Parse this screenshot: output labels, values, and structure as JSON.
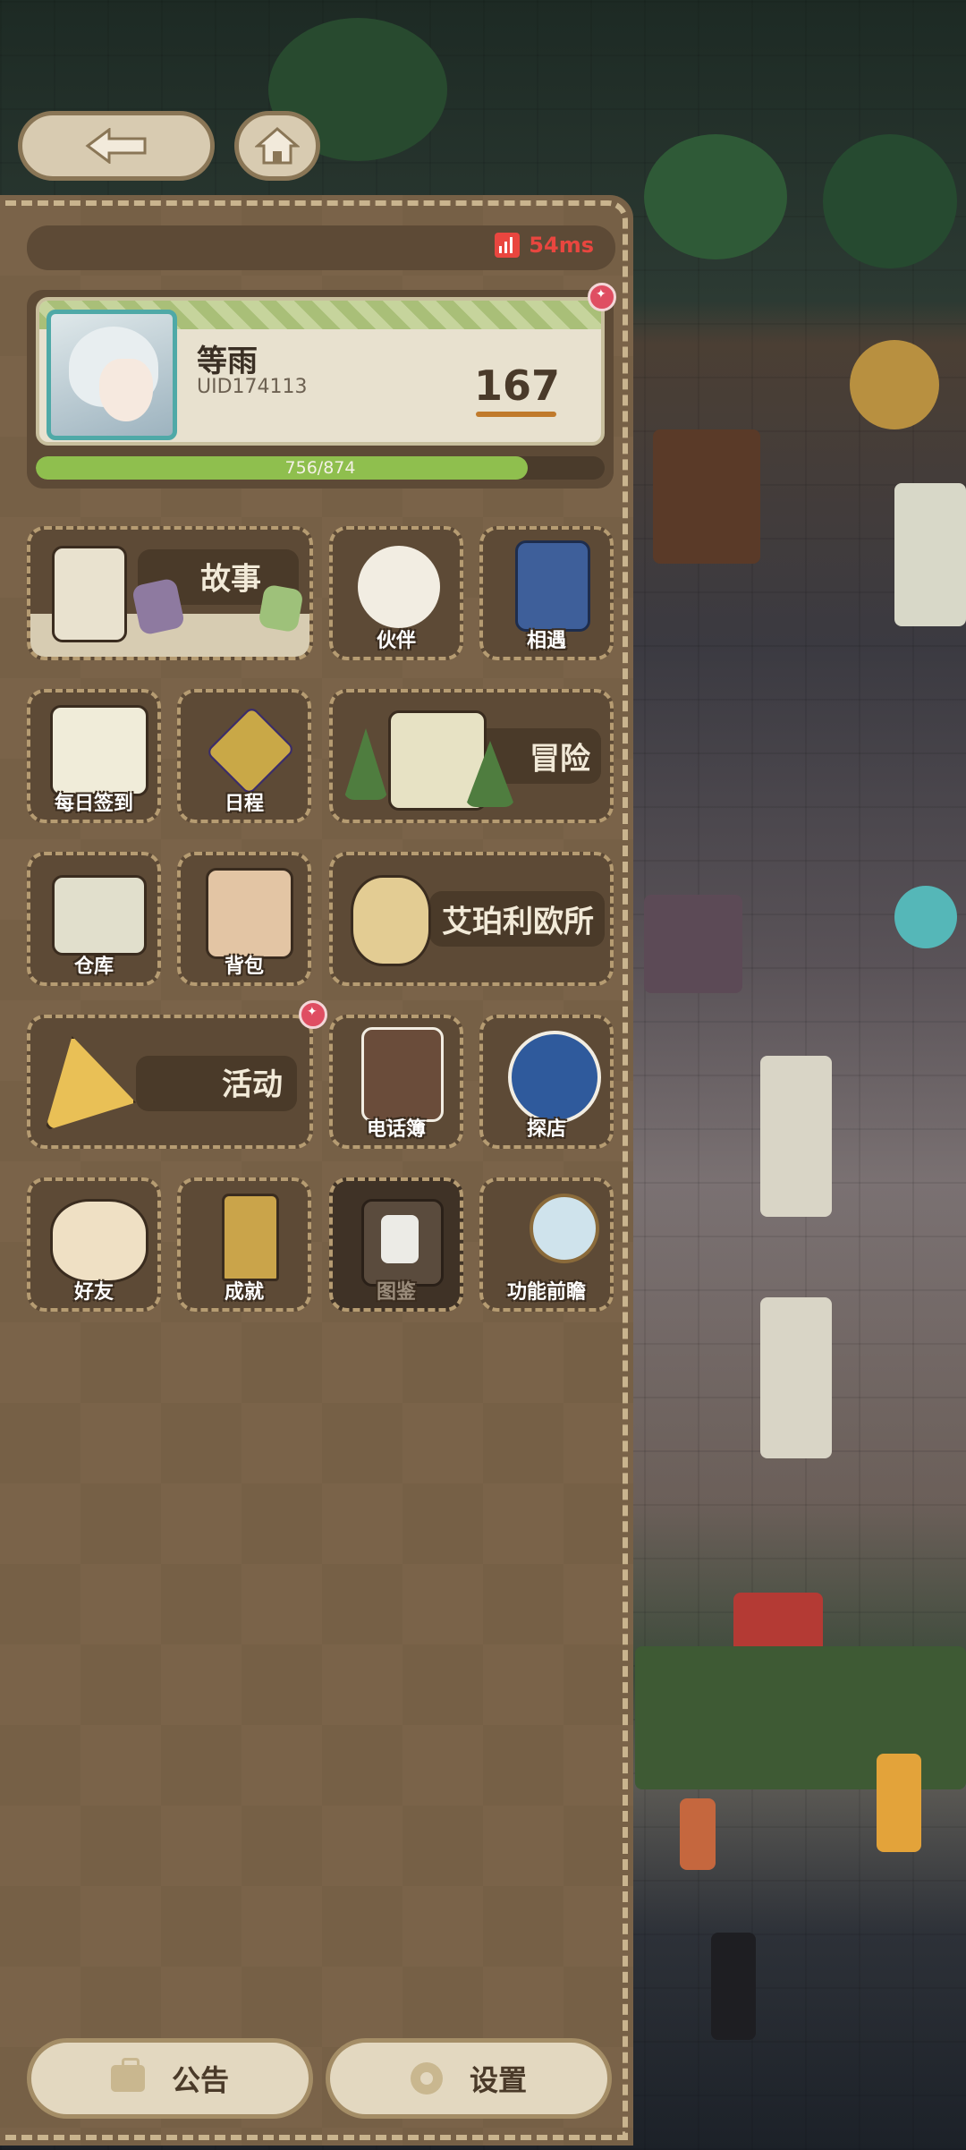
{
  "status": {
    "ping": "54ms"
  },
  "profile": {
    "name": "等雨",
    "uid": "UID174113",
    "level": "167",
    "exp_text": "756/874",
    "exp_fraction": 0.865
  },
  "menu": {
    "story": "故事",
    "partner": "伙伴",
    "encounter": "相遇",
    "daily_checkin": "每日签到",
    "schedule": "日程",
    "adventure": "冒险",
    "warehouse": "仓库",
    "backpack": "背包",
    "agency": "艾珀利欧所",
    "events": "活动",
    "phonebook": "电话簿",
    "visit_shop": "探店",
    "friends": "好友",
    "achievements": "成就",
    "codex": "图鉴",
    "feature_preview": "功能前瞻"
  },
  "bottom": {
    "announcement": "公告",
    "settings": "设置"
  },
  "colors": {
    "panel": "#7a6349",
    "tile": "#5d4a36",
    "accent_red": "#e9463f",
    "exp_green": "#8fbf4e",
    "badge": "#df4e62"
  }
}
